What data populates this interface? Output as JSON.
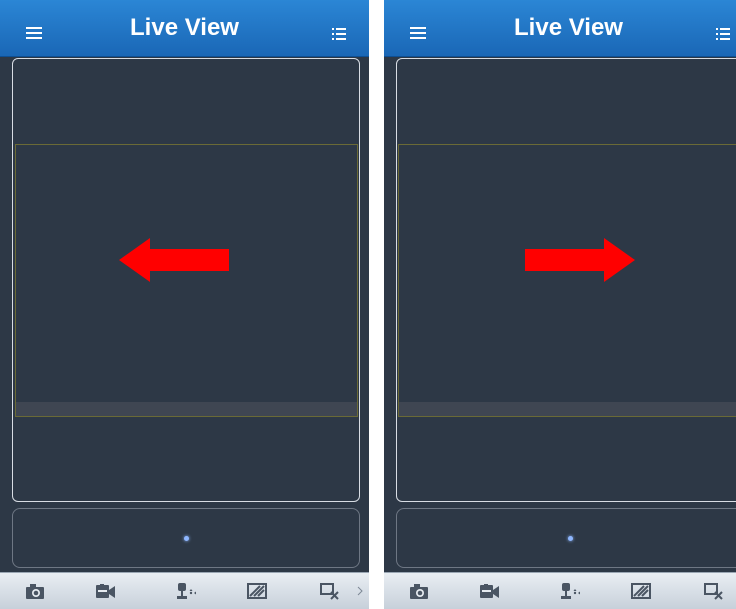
{
  "screens": [
    {
      "header": {
        "title": "Live View",
        "menu_icon": "hamburger-menu-icon",
        "list_icon": "list-icon"
      },
      "annotation": {
        "arrow_direction": "left",
        "arrow_color": "#ff0000"
      },
      "toolbar": {
        "items": [
          {
            "icon": "camera-icon"
          },
          {
            "icon": "video-record-icon"
          },
          {
            "icon": "ptz-control-icon"
          },
          {
            "icon": "image-settings-icon"
          },
          {
            "icon": "close-window-icon"
          }
        ]
      }
    },
    {
      "header": {
        "title": "Live View",
        "menu_icon": "hamburger-menu-icon",
        "list_icon": "list-icon"
      },
      "annotation": {
        "arrow_direction": "right",
        "arrow_color": "#ff0000"
      },
      "toolbar": {
        "items": [
          {
            "icon": "camera-icon"
          },
          {
            "icon": "video-record-icon"
          },
          {
            "icon": "ptz-control-icon"
          },
          {
            "icon": "image-settings-icon"
          },
          {
            "icon": "close-window-icon"
          }
        ]
      }
    }
  ],
  "colors": {
    "header_blue": "#1f73c4",
    "background": "#2d3846",
    "arrow_red": "#ff0000",
    "toolbar_gray": "#d8dfe6"
  }
}
